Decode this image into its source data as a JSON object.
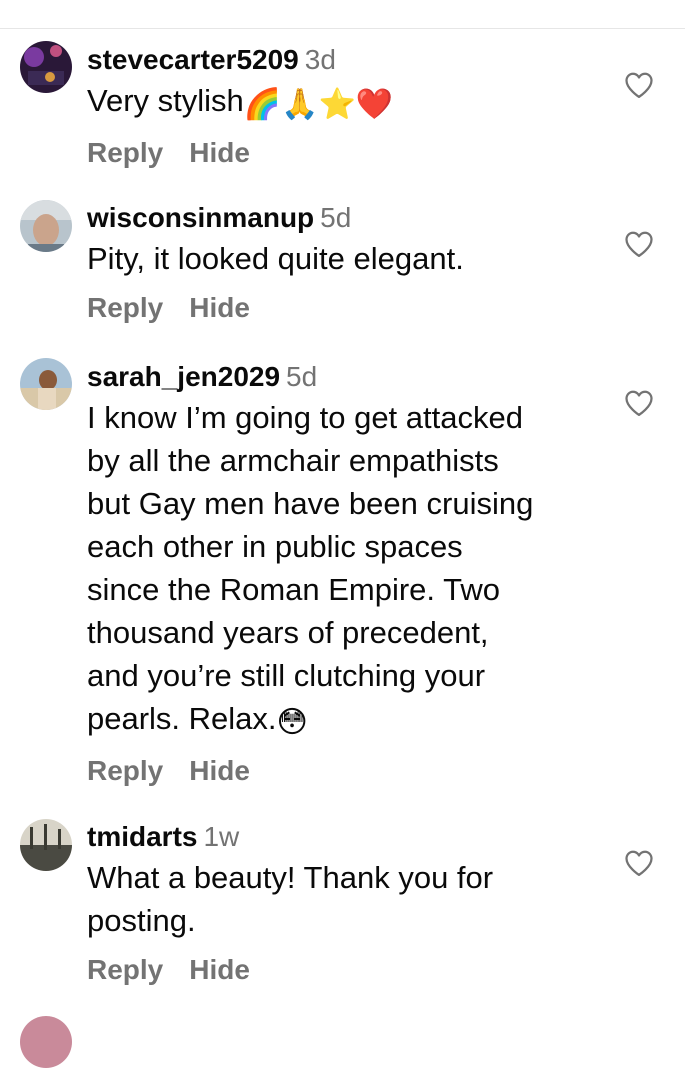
{
  "comments": [
    {
      "username": "stevecarter5209",
      "age": "3d",
      "text": "Very stylish",
      "emojis": [
        "🌈",
        "🙏",
        "⭐",
        "❤️"
      ],
      "reply_label": "Reply",
      "hide_label": "Hide"
    },
    {
      "username": "wisconsinmanup",
      "age": "5d",
      "text": "Pity, it looked quite elegant.",
      "reply_label": "Reply",
      "hide_label": "Hide"
    },
    {
      "username": "sarah_jen2029",
      "age": "5d",
      "lines": [
        "I know I’m going to get attacked",
        "by all the armchair empathists",
        "but Gay men have been cruising",
        "each other in public spaces",
        "since the Roman Empire. Two",
        "thousand years of precedent,",
        "and you’re still clutching your",
        "pearls. Relax."
      ],
      "emoji": "😳",
      "reply_label": "Reply",
      "hide_label": "Hide"
    },
    {
      "username": "tmidarts",
      "age": "1w",
      "lines": [
        "What a beauty! Thank you for",
        "posting."
      ],
      "reply_label": "Reply",
      "hide_label": "Hide"
    }
  ],
  "icons": {
    "like": "heart-outline-icon"
  },
  "colors": {
    "text": "#0a0a0a",
    "muted": "#737373",
    "background": "#ffffff"
  }
}
